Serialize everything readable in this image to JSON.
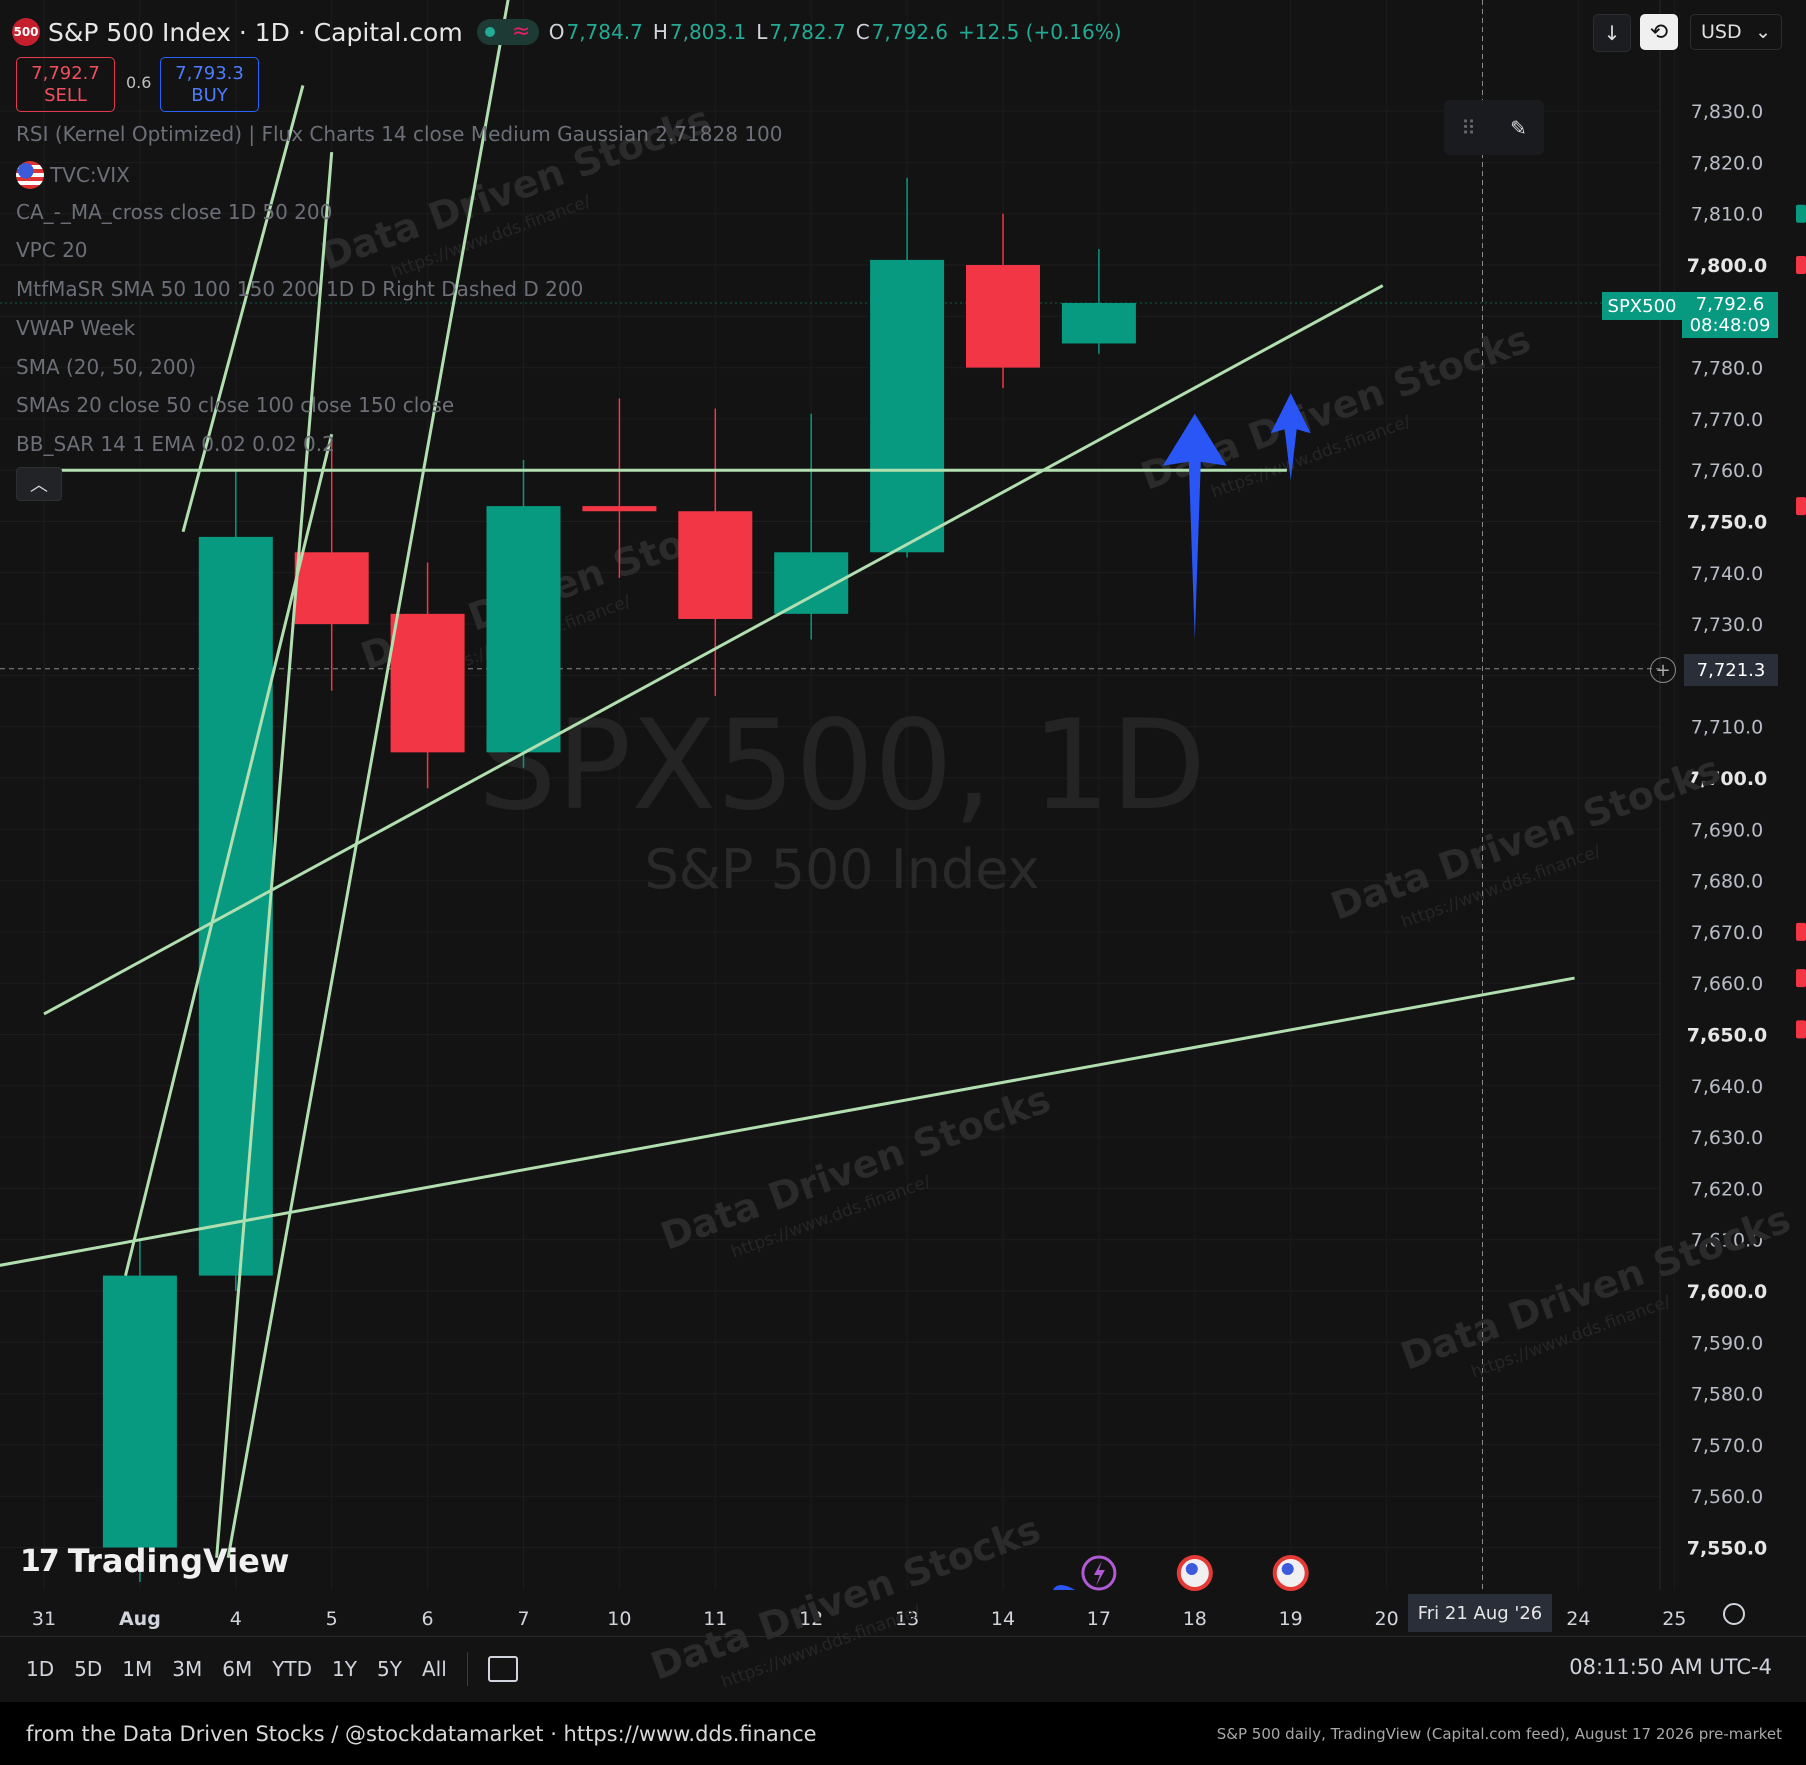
{
  "header": {
    "symbol_badge": "500",
    "title": "S&P 500 Index · 1D · Capital.com",
    "ohlc": {
      "o_label": "O",
      "o": "7,784.7",
      "h_label": "H",
      "h": "7,803.1",
      "l_label": "L",
      "l": "7,782.7",
      "c_label": "C",
      "c": "7,792.6",
      "change": "+12.5 (+0.16%)"
    }
  },
  "trade": {
    "sell_price": "7,792.7",
    "sell_label": "SELL",
    "spread": "0.6",
    "buy_price": "7,793.3",
    "buy_label": "BUY"
  },
  "indicators": [
    "RSI (Kernel Optimized) | Flux Charts 14 close Medium Gaussian 2.71828 100",
    "TVC:VIX",
    "CA_-_MA_cross close 1D 50 200",
    "VPC 20",
    "MtfMaSR SMA 50 100 150 200 1D D Right Dashed D 200",
    "VWAP Week",
    "SMA (20, 50, 200)",
    "SMAs 20 close 50 close 100 close 150 close",
    "BB_SAR 14 1 EMA 0.02 0.02 0.2"
  ],
  "toolbar_right": {
    "currency": "USD"
  },
  "price_tags": {
    "symbol": "SPX500",
    "last": "7,792.6",
    "countdown": "08:48:09",
    "crosshair": "7,721.3",
    "crosshair_date": "Fri 21 Aug '26"
  },
  "watermark": {
    "line1": "SPX500, 1D",
    "line2": "S&P 500 Index"
  },
  "overlay_watermark": {
    "text": "Data Driven Stocks",
    "url": "https://www.dds.finance/"
  },
  "colors": {
    "up": "#089981",
    "down": "#f23645",
    "trendline": "#b2dfb0",
    "arrow": "#2956f5",
    "background": "#131313"
  },
  "tv_logo": "TradingView",
  "ranges": [
    "1D",
    "5D",
    "1M",
    "3M",
    "6M",
    "YTD",
    "1Y",
    "5Y",
    "All"
  ],
  "clock": "08:11:50 AM UTC-4",
  "footer": {
    "left": "from the Data Driven Stocks / @stockdatamarket   ·   https://www.dds.finance",
    "right": "S&P 500 daily, TradingView (Capital.com feed), August 17 2026 pre-market"
  },
  "chart_data": {
    "type": "candlestick",
    "x_labels": [
      "31",
      "Aug",
      "4",
      "5",
      "6",
      "7",
      "10",
      "11",
      "12",
      "13",
      "14",
      "17",
      "18",
      "19",
      "20",
      "Fri 21 Aug '26",
      "24",
      "25"
    ],
    "candles": [
      {
        "date": "Aug 3",
        "open": 7550.0,
        "high": 7610.0,
        "low": 7540.0,
        "close": 7603.0
      },
      {
        "date": "Aug 4",
        "open": 7603.0,
        "high": 7760.0,
        "low": 7600.0,
        "close": 7747.0
      },
      {
        "date": "Aug 5",
        "open": 7744.0,
        "high": 7766.0,
        "low": 7717.0,
        "close": 7730.0
      },
      {
        "date": "Aug 6",
        "open": 7732.0,
        "high": 7742.0,
        "low": 7698.0,
        "close": 7705.0
      },
      {
        "date": "Aug 7",
        "open": 7705.0,
        "high": 7762.0,
        "low": 7702.0,
        "close": 7753.0
      },
      {
        "date": "Aug 10",
        "open": 7753.0,
        "high": 7774.0,
        "low": 7739.0,
        "close": 7752.0
      },
      {
        "date": "Aug 11",
        "open": 7752.0,
        "high": 7772.0,
        "low": 7716.0,
        "close": 7731.0
      },
      {
        "date": "Aug 12",
        "open": 7732.0,
        "high": 7771.0,
        "low": 7727.0,
        "close": 7744.0
      },
      {
        "date": "Aug 13",
        "open": 7744.0,
        "high": 7817.0,
        "low": 7743.0,
        "close": 7801.0
      },
      {
        "date": "Aug 14",
        "open": 7800.0,
        "high": 7810.0,
        "low": 7776.0,
        "close": 7780.0
      },
      {
        "date": "Aug 17",
        "open": 7784.7,
        "high": 7803.1,
        "low": 7782.7,
        "close": 7792.6
      }
    ],
    "y_ticks": [
      "7,830.0",
      "7,820.0",
      "7,810.0",
      "7,800.0",
      "7,790.0",
      "7,780.0",
      "7,770.0",
      "7,760.0",
      "7,750.0",
      "7,740.0",
      "7,730.0",
      "7,720.0",
      "7,710.0",
      "7,700.0",
      "7,690.0",
      "7,680.0",
      "7,670.0",
      "7,660.0",
      "7,650.0",
      "7,640.0",
      "7,630.0",
      "7,620.0",
      "7,610.0",
      "7,600.0",
      "7,590.0",
      "7,580.0",
      "7,570.0",
      "7,560.0",
      "7,550.0"
    ],
    "ylim": [
      7545,
      7835
    ],
    "horizontal_level": 7760.0,
    "grid": true
  }
}
